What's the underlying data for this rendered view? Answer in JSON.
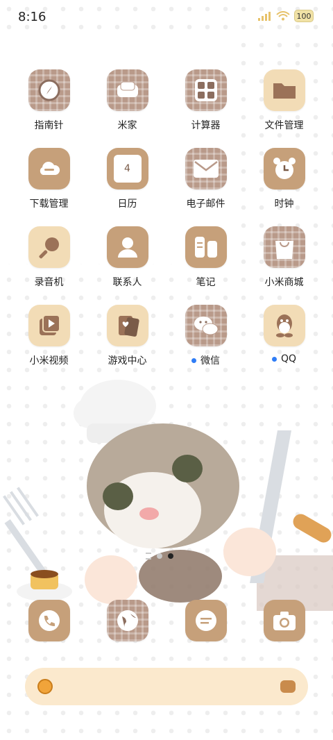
{
  "status": {
    "time": "8:16",
    "battery": "100"
  },
  "apps": [
    {
      "label": "指南针",
      "icon": "compass-icon",
      "has_dot": false
    },
    {
      "label": "米家",
      "icon": "sofa-icon",
      "has_dot": false
    },
    {
      "label": "计算器",
      "icon": "calculator-icon",
      "has_dot": false
    },
    {
      "label": "文件管理",
      "icon": "folder-icon",
      "has_dot": false
    },
    {
      "label": "下载管理",
      "icon": "download-cloud-icon",
      "has_dot": false
    },
    {
      "label": "日历",
      "icon": "calendar-icon",
      "has_dot": false,
      "calendar_day": "4"
    },
    {
      "label": "电子邮件",
      "icon": "mail-icon",
      "has_dot": false
    },
    {
      "label": "时钟",
      "icon": "alarm-clock-icon",
      "has_dot": false
    },
    {
      "label": "录音机",
      "icon": "microphone-icon",
      "has_dot": false
    },
    {
      "label": "联系人",
      "icon": "contact-person-icon",
      "has_dot": false
    },
    {
      "label": "笔记",
      "icon": "notes-icon",
      "has_dot": false
    },
    {
      "label": "小米商城",
      "icon": "shopping-bag-icon",
      "has_dot": false
    },
    {
      "label": "小米视频",
      "icon": "video-icon",
      "has_dot": false
    },
    {
      "label": "游戏中心",
      "icon": "game-cards-icon",
      "has_dot": false
    },
    {
      "label": "微信",
      "icon": "wechat-icon",
      "has_dot": true
    },
    {
      "label": "QQ",
      "icon": "qq-penguin-icon",
      "has_dot": true
    }
  ],
  "dock": [
    {
      "name": "phone",
      "icon": "phone-icon"
    },
    {
      "name": "browser",
      "icon": "globe-icon"
    },
    {
      "name": "messages",
      "icon": "message-icon"
    },
    {
      "name": "camera",
      "icon": "camera-icon"
    }
  ],
  "pager": {
    "pages": 2,
    "current": 2
  },
  "colors": {
    "plaid": "#b99a8a",
    "tan": "#c6a07a",
    "beige": "#f2dcb6",
    "notification_dot": "#2f7df6",
    "search_bar": "#fbe9cd"
  }
}
